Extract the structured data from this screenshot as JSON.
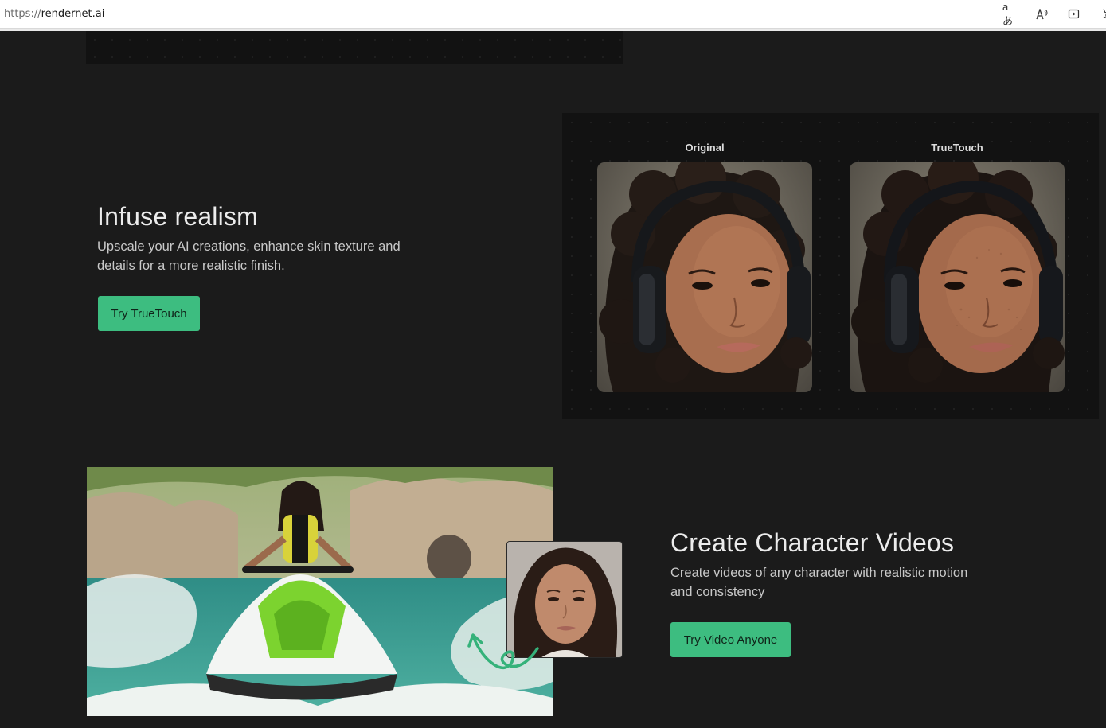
{
  "browser": {
    "url_scheme": "https://",
    "url_host": "rendernet.ai",
    "icons": [
      "translate-icon",
      "read-aloud-icon",
      "media-icon",
      "favorite-icon"
    ],
    "icon_glyphs": [
      "aあ",
      "Aͅ",
      "▷",
      "☆"
    ]
  },
  "section_realism": {
    "title": "Infuse realism",
    "description_line1": "Upscale your AI creations, enhance skin texture and",
    "description_line2": "details for a more realistic finish.",
    "button_label": "Try TrueTouch",
    "compare": {
      "left_label": "Original",
      "right_label": "TrueTouch"
    }
  },
  "section_video": {
    "title": "Create Character Videos",
    "description_line1": "Create videos of any character with realistic motion",
    "description_line2": "and consistency",
    "button_label": "Try Video Anyone"
  },
  "colors": {
    "page_bg": "#1b1b1b",
    "panel_bg": "#121212",
    "accent": "#3dbd80"
  }
}
